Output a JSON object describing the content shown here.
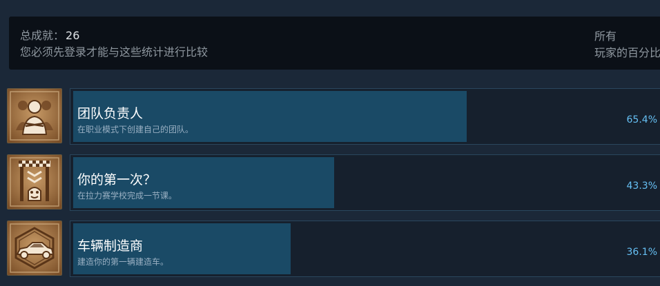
{
  "summary": {
    "total_label": "总成就：",
    "total_count": "26",
    "login_note": "您必须先登录才能与这些统计进行比较",
    "column_header_line1": "所有",
    "column_header_line2": "玩家的百分比"
  },
  "achievements": [
    {
      "icon": "team-manager-icon",
      "title": "团队负责人",
      "description": "在职业模式下创建自己的团队。",
      "percent_label": "65.4%",
      "percent": 65.4
    },
    {
      "icon": "first-time-rally-icon",
      "title": "你的第一次？",
      "description": "在拉力赛学校完成一节课。",
      "percent_label": "43.3%",
      "percent": 43.3
    },
    {
      "icon": "car-builder-icon",
      "title": "车辆制造商",
      "description": "建造你的第一辆建造车。",
      "percent_label": "36.1%",
      "percent": 36.1
    }
  ],
  "colors": {
    "page_bg": "#1b2838",
    "bar_fill": "#1a4a66",
    "percent_text": "#66c0f4",
    "icon_bronze": "#9a6a3a"
  }
}
